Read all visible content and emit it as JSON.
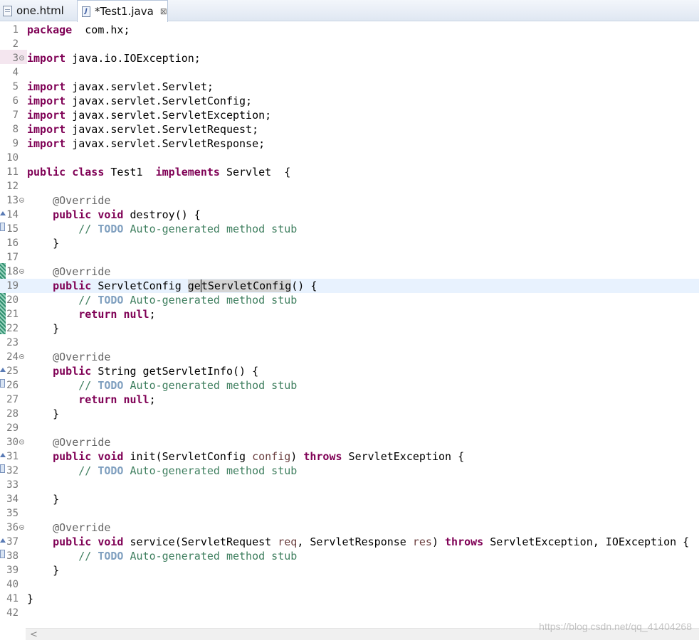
{
  "tabs": [
    {
      "label": "one.html",
      "icon": "html-file-icon",
      "active": false
    },
    {
      "label": "*Test1.java",
      "icon": "java-file-icon",
      "active": true,
      "close": "⊠"
    }
  ],
  "editor": {
    "current_line": 19,
    "lines": [
      {
        "n": "1",
        "t": [
          [
            "kw",
            "package"
          ],
          [
            "",
            "  com.hx;"
          ]
        ]
      },
      {
        "n": "2",
        "t": []
      },
      {
        "n": "3",
        "fold": true,
        "t": [
          [
            "kw",
            "import"
          ],
          [
            "",
            " java.io.IOException;"
          ]
        ]
      },
      {
        "n": "4",
        "t": []
      },
      {
        "n": "5",
        "t": [
          [
            "kw",
            "import"
          ],
          [
            "",
            " javax.servlet.Servlet;"
          ]
        ]
      },
      {
        "n": "6",
        "t": [
          [
            "kw",
            "import"
          ],
          [
            "",
            " javax.servlet.ServletConfig;"
          ]
        ]
      },
      {
        "n": "7",
        "t": [
          [
            "kw",
            "import"
          ],
          [
            "",
            " javax.servlet.ServletException;"
          ]
        ]
      },
      {
        "n": "8",
        "t": [
          [
            "kw",
            "import"
          ],
          [
            "",
            " javax.servlet.ServletRequest;"
          ]
        ]
      },
      {
        "n": "9",
        "t": [
          [
            "kw",
            "import"
          ],
          [
            "",
            " javax.servlet.ServletResponse;"
          ]
        ]
      },
      {
        "n": "10",
        "t": []
      },
      {
        "n": "11",
        "t": [
          [
            "kw",
            "public"
          ],
          [
            "",
            " "
          ],
          [
            "kw",
            "class"
          ],
          [
            "",
            " Test1  "
          ],
          [
            "kw",
            "implements"
          ],
          [
            "",
            " Servlet  {"
          ]
        ]
      },
      {
        "n": "12",
        "t": []
      },
      {
        "n": "13",
        "fold": true,
        "t": [
          [
            "",
            "    "
          ],
          [
            "ann",
            "@Override"
          ]
        ]
      },
      {
        "n": "14",
        "t": [
          [
            "",
            "    "
          ],
          [
            "kw",
            "public"
          ],
          [
            "",
            " "
          ],
          [
            "kw",
            "void"
          ],
          [
            "",
            " destroy() {"
          ]
        ]
      },
      {
        "n": "15",
        "t": [
          [
            "",
            "        "
          ],
          [
            "cm",
            "// "
          ],
          [
            "todo",
            "TODO"
          ],
          [
            "cm",
            " Auto-generated method stub"
          ]
        ]
      },
      {
        "n": "16",
        "t": [
          [
            "",
            "    }"
          ]
        ]
      },
      {
        "n": "17",
        "t": []
      },
      {
        "n": "18",
        "fold": true,
        "t": [
          [
            "",
            "    "
          ],
          [
            "ann",
            "@Override"
          ]
        ]
      },
      {
        "n": "19",
        "t": [
          [
            "",
            "    "
          ],
          [
            "kw",
            "public"
          ],
          [
            "",
            " ServletConfig "
          ],
          [
            "hl",
            "ge"
          ],
          [
            "hlc",
            "tServletConfig"
          ],
          [
            "",
            "() {"
          ]
        ]
      },
      {
        "n": "20",
        "t": [
          [
            "",
            "        "
          ],
          [
            "cm",
            "// "
          ],
          [
            "todo",
            "TODO"
          ],
          [
            "cm",
            " Auto-generated method stub"
          ]
        ]
      },
      {
        "n": "21",
        "t": [
          [
            "",
            "        "
          ],
          [
            "kw",
            "return"
          ],
          [
            "",
            " "
          ],
          [
            "kw",
            "null"
          ],
          [
            "",
            ";"
          ]
        ]
      },
      {
        "n": "22",
        "t": [
          [
            "",
            "    }"
          ]
        ]
      },
      {
        "n": "23",
        "t": []
      },
      {
        "n": "24",
        "fold": true,
        "t": [
          [
            "",
            "    "
          ],
          [
            "ann",
            "@Override"
          ]
        ]
      },
      {
        "n": "25",
        "t": [
          [
            "",
            "    "
          ],
          [
            "kw",
            "public"
          ],
          [
            "",
            " String getServletInfo() {"
          ]
        ]
      },
      {
        "n": "26",
        "t": [
          [
            "",
            "        "
          ],
          [
            "cm",
            "// "
          ],
          [
            "todo",
            "TODO"
          ],
          [
            "cm",
            " Auto-generated method stub"
          ]
        ]
      },
      {
        "n": "27",
        "t": [
          [
            "",
            "        "
          ],
          [
            "kw",
            "return"
          ],
          [
            "",
            " "
          ],
          [
            "kw",
            "null"
          ],
          [
            "",
            ";"
          ]
        ]
      },
      {
        "n": "28",
        "t": [
          [
            "",
            "    }"
          ]
        ]
      },
      {
        "n": "29",
        "t": []
      },
      {
        "n": "30",
        "fold": true,
        "t": [
          [
            "",
            "    "
          ],
          [
            "ann",
            "@Override"
          ]
        ]
      },
      {
        "n": "31",
        "t": [
          [
            "",
            "    "
          ],
          [
            "kw",
            "public"
          ],
          [
            "",
            " "
          ],
          [
            "kw",
            "void"
          ],
          [
            "",
            " init(ServletConfig "
          ],
          [
            "par",
            "config"
          ],
          [
            "",
            ") "
          ],
          [
            "kw",
            "throws"
          ],
          [
            "",
            " ServletException {"
          ]
        ]
      },
      {
        "n": "32",
        "t": [
          [
            "",
            "        "
          ],
          [
            "cm",
            "// "
          ],
          [
            "todo",
            "TODO"
          ],
          [
            "cm",
            " Auto-generated method stub"
          ]
        ]
      },
      {
        "n": "33",
        "t": []
      },
      {
        "n": "34",
        "t": [
          [
            "",
            "    }"
          ]
        ]
      },
      {
        "n": "35",
        "t": []
      },
      {
        "n": "36",
        "fold": true,
        "t": [
          [
            "",
            "    "
          ],
          [
            "ann",
            "@Override"
          ]
        ]
      },
      {
        "n": "37",
        "t": [
          [
            "",
            "    "
          ],
          [
            "kw",
            "public"
          ],
          [
            "",
            " "
          ],
          [
            "kw",
            "void"
          ],
          [
            "",
            " service(ServletRequest "
          ],
          [
            "par",
            "req"
          ],
          [
            "",
            ", ServletResponse "
          ],
          [
            "par",
            "res"
          ],
          [
            "",
            ") "
          ],
          [
            "kw",
            "throws"
          ],
          [
            "",
            " ServletException, IOException {"
          ]
        ]
      },
      {
        "n": "38",
        "t": [
          [
            "",
            "        "
          ],
          [
            "cm",
            "// "
          ],
          [
            "todo",
            "TODO"
          ],
          [
            "cm",
            " Auto-generated method stub"
          ]
        ]
      },
      {
        "n": "39",
        "t": [
          [
            "",
            "    }"
          ]
        ]
      },
      {
        "n": "40",
        "t": []
      },
      {
        "n": "41",
        "t": [
          [
            "",
            "}"
          ]
        ]
      },
      {
        "n": "42",
        "t": []
      }
    ]
  },
  "scroll_arrow": "<",
  "watermark": "https://blog.csdn.net/qq_41404268"
}
